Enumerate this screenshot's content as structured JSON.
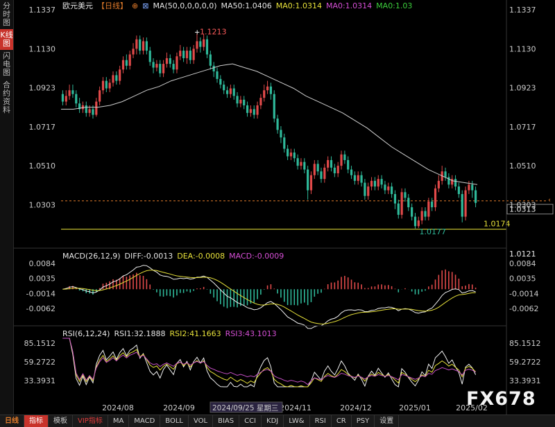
{
  "sidebar": {
    "tabs": [
      {
        "label": "分时图",
        "active": false
      },
      {
        "label": "K线图",
        "active": true
      },
      {
        "label": "闪电图",
        "active": false
      },
      {
        "label": "合约资料",
        "active": false
      }
    ]
  },
  "header": {
    "symbol": "欧元美元",
    "period": "【日线】",
    "ma_label": "MA(50,0,0,0,0,0)",
    "ma50_label": "MA50:1.0406",
    "ma0_1": "MA0:1.0314",
    "ma0_2": "MA0:1.0314",
    "ma0_3": "MA0:1.03"
  },
  "price_axis": {
    "ticks": [
      "1.1337",
      "1.1130",
      "1.0923",
      "1.0717",
      "1.0510",
      "1.0303"
    ]
  },
  "price_labels": {
    "high": "1.1213",
    "low": "1.0177",
    "support": "1.0174",
    "current": "1.0313",
    "extra": "1.0121"
  },
  "macd": {
    "title": "MACD(26,12,9)",
    "diff": "DIFF:-0.0013",
    "dea": "DEA:-0.0008",
    "macd": "MACD:-0.0009",
    "ticks": [
      "0.0084",
      "0.0035",
      "-0.0014",
      "-0.0062"
    ]
  },
  "rsi": {
    "title": "RSI(6,12,24)",
    "rsi1": "RSI1:32.1888",
    "rsi2": "RSI2:41.1663",
    "rsi3": "RSI3:43.1013",
    "ticks": [
      "85.1512",
      "59.2722",
      "33.3931"
    ]
  },
  "date_axis": {
    "labels": [
      "2024/08",
      "2024/09",
      "2024/11",
      "2024/12",
      "2025/01",
      "2025/02"
    ],
    "crosshair": "2024/09/25 星期三"
  },
  "bottom_tabs": [
    {
      "label": "日线",
      "state": "period"
    },
    {
      "label": "指标",
      "state": "active"
    },
    {
      "label": "模板",
      "state": ""
    },
    {
      "label": "VIP指标",
      "state": "hl"
    },
    {
      "label": "MA",
      "state": ""
    },
    {
      "label": "MACD",
      "state": ""
    },
    {
      "label": "BOLL",
      "state": ""
    },
    {
      "label": "VOL",
      "state": ""
    },
    {
      "label": "BIAS",
      "state": ""
    },
    {
      "label": "CCI",
      "state": ""
    },
    {
      "label": "KDJ",
      "state": ""
    },
    {
      "label": "LW&",
      "state": ""
    },
    {
      "label": "RSI",
      "state": ""
    },
    {
      "label": "CR",
      "state": ""
    },
    {
      "label": "PSY",
      "state": ""
    },
    {
      "label": "设置",
      "state": ""
    }
  ],
  "watermark": "FX678",
  "colors": {
    "up": "#e24a4a",
    "down": "#2fb99a",
    "ma50": "#cfcfcf",
    "dashed": "#e07a2a",
    "support": "#e8e23a",
    "diff": "#f2f2f2",
    "dea": "#e8e23a",
    "macd": "#d64fd6",
    "rsi1": "#f2f2f2",
    "rsi2": "#e8e23a",
    "rsi3": "#c34fc3"
  },
  "chart_data": {
    "type": "candlestick",
    "ylim": [
      1.0121,
      1.1337
    ],
    "candles": [
      [
        1.089,
        1.085,
        1.091,
        1.083
      ],
      [
        1.085,
        1.088,
        1.091,
        1.083
      ],
      [
        1.088,
        1.091,
        1.094,
        1.086
      ],
      [
        1.091,
        1.089,
        1.094,
        1.087
      ],
      [
        1.089,
        1.084,
        1.091,
        1.082
      ],
      [
        1.084,
        1.081,
        1.087,
        1.079
      ],
      [
        1.081,
        1.083,
        1.085,
        1.079
      ],
      [
        1.083,
        1.079,
        1.085,
        1.077
      ],
      [
        1.079,
        1.081,
        1.083,
        1.077
      ],
      [
        1.081,
        1.078,
        1.083,
        1.076
      ],
      [
        1.078,
        1.085,
        1.087,
        1.077
      ],
      [
        1.085,
        1.091,
        1.093,
        1.083
      ],
      [
        1.091,
        1.096,
        1.098,
        1.089
      ],
      [
        1.096,
        1.092,
        1.098,
        1.09
      ],
      [
        1.092,
        1.095,
        1.097,
        1.09
      ],
      [
        1.095,
        1.099,
        1.101,
        1.093
      ],
      [
        1.099,
        1.096,
        1.101,
        1.094
      ],
      [
        1.096,
        1.102,
        1.104,
        1.094
      ],
      [
        1.102,
        1.107,
        1.109,
        1.1
      ],
      [
        1.107,
        1.104,
        1.11,
        1.102
      ],
      [
        1.104,
        1.11,
        1.112,
        1.102
      ],
      [
        1.11,
        1.113,
        1.116,
        1.108
      ],
      [
        1.113,
        1.118,
        1.12,
        1.11
      ],
      [
        1.118,
        1.112,
        1.12,
        1.11
      ],
      [
        1.112,
        1.117,
        1.119,
        1.11
      ],
      [
        1.117,
        1.112,
        1.119,
        1.11
      ],
      [
        1.112,
        1.106,
        1.114,
        1.104
      ],
      [
        1.106,
        1.103,
        1.108,
        1.1
      ],
      [
        1.103,
        1.105,
        1.107,
        1.101
      ],
      [
        1.105,
        1.1,
        1.107,
        1.098
      ],
      [
        1.1,
        1.105,
        1.107,
        1.098
      ],
      [
        1.105,
        1.108,
        1.111,
        1.103
      ],
      [
        1.108,
        1.105,
        1.11,
        1.103
      ],
      [
        1.105,
        1.102,
        1.107,
        1.1
      ],
      [
        1.102,
        1.109,
        1.111,
        1.1
      ],
      [
        1.109,
        1.112,
        1.115,
        1.107
      ],
      [
        1.112,
        1.108,
        1.114,
        1.106
      ],
      [
        1.108,
        1.112,
        1.114,
        1.105
      ],
      [
        1.112,
        1.107,
        1.114,
        1.105
      ],
      [
        1.107,
        1.113,
        1.115,
        1.105
      ],
      [
        1.113,
        1.117,
        1.121,
        1.111
      ],
      [
        1.117,
        1.114,
        1.119,
        1.111
      ],
      [
        1.114,
        1.118,
        1.121,
        1.112
      ],
      [
        1.118,
        1.11,
        1.12,
        1.108
      ],
      [
        1.11,
        1.104,
        1.112,
        1.102
      ],
      [
        1.104,
        1.101,
        1.106,
        1.098
      ],
      [
        1.101,
        1.097,
        1.103,
        1.095
      ],
      [
        1.097,
        1.094,
        1.099,
        1.092
      ],
      [
        1.094,
        1.091,
        1.096,
        1.089
      ],
      [
        1.091,
        1.089,
        1.093,
        1.087
      ],
      [
        1.089,
        1.092,
        1.094,
        1.087
      ],
      [
        1.092,
        1.088,
        1.094,
        1.086
      ],
      [
        1.088,
        1.084,
        1.09,
        1.082
      ],
      [
        1.084,
        1.086,
        1.088,
        1.082
      ],
      [
        1.086,
        1.083,
        1.088,
        1.081
      ],
      [
        1.083,
        1.079,
        1.085,
        1.077
      ],
      [
        1.079,
        1.081,
        1.083,
        1.077
      ],
      [
        1.081,
        1.078,
        1.083,
        1.076
      ],
      [
        1.078,
        1.083,
        1.085,
        1.076
      ],
      [
        1.083,
        1.087,
        1.089,
        1.081
      ],
      [
        1.087,
        1.091,
        1.094,
        1.085
      ],
      [
        1.091,
        1.093,
        1.096,
        1.089
      ],
      [
        1.093,
        1.089,
        1.095,
        1.086
      ],
      [
        1.089,
        1.076,
        1.091,
        1.074
      ],
      [
        1.076,
        1.07,
        1.078,
        1.068
      ],
      [
        1.07,
        1.066,
        1.072,
        1.063
      ],
      [
        1.066,
        1.06,
        1.068,
        1.058
      ],
      [
        1.06,
        1.056,
        1.062,
        1.054
      ],
      [
        1.056,
        1.058,
        1.06,
        1.054
      ],
      [
        1.058,
        1.055,
        1.06,
        1.053
      ],
      [
        1.055,
        1.051,
        1.057,
        1.049
      ],
      [
        1.051,
        1.053,
        1.055,
        1.049
      ],
      [
        1.053,
        1.049,
        1.055,
        1.047
      ],
      [
        1.049,
        1.038,
        1.051,
        1.033
      ],
      [
        1.038,
        1.046,
        1.048,
        1.036
      ],
      [
        1.046,
        1.052,
        1.054,
        1.044
      ],
      [
        1.052,
        1.048,
        1.054,
        1.046
      ],
      [
        1.048,
        1.044,
        1.05,
        1.042
      ],
      [
        1.044,
        1.05,
        1.052,
        1.042
      ],
      [
        1.05,
        1.054,
        1.056,
        1.048
      ],
      [
        1.054,
        1.05,
        1.056,
        1.048
      ],
      [
        1.05,
        1.047,
        1.052,
        1.045
      ],
      [
        1.047,
        1.051,
        1.053,
        1.045
      ],
      [
        1.051,
        1.057,
        1.059,
        1.049
      ],
      [
        1.057,
        1.054,
        1.059,
        1.052
      ],
      [
        1.054,
        1.049,
        1.056,
        1.047
      ],
      [
        1.049,
        1.046,
        1.051,
        1.044
      ],
      [
        1.046,
        1.043,
        1.048,
        1.041
      ],
      [
        1.043,
        1.046,
        1.048,
        1.041
      ],
      [
        1.046,
        1.042,
        1.048,
        1.04
      ],
      [
        1.042,
        1.035,
        1.044,
        1.033
      ],
      [
        1.035,
        1.04,
        1.042,
        1.033
      ],
      [
        1.04,
        1.043,
        1.045,
        1.038
      ],
      [
        1.043,
        1.04,
        1.045,
        1.038
      ],
      [
        1.04,
        1.044,
        1.046,
        1.038
      ],
      [
        1.044,
        1.041,
        1.046,
        1.039
      ],
      [
        1.041,
        1.038,
        1.043,
        1.036
      ],
      [
        1.038,
        1.04,
        1.042,
        1.036
      ],
      [
        1.04,
        1.036,
        1.042,
        1.034
      ],
      [
        1.036,
        1.031,
        1.038,
        1.028
      ],
      [
        1.031,
        1.025,
        1.033,
        1.023
      ],
      [
        1.025,
        1.037,
        1.039,
        1.023
      ],
      [
        1.037,
        1.034,
        1.039,
        1.032
      ],
      [
        1.034,
        1.029,
        1.036,
        1.027
      ],
      [
        1.029,
        1.024,
        1.031,
        1.022
      ],
      [
        1.024,
        1.019,
        1.026,
        1.0177
      ],
      [
        1.019,
        1.022,
        1.024,
        1.018
      ],
      [
        1.022,
        1.027,
        1.029,
        1.02
      ],
      [
        1.027,
        1.024,
        1.029,
        1.022
      ],
      [
        1.024,
        1.032,
        1.034,
        1.022
      ],
      [
        1.032,
        1.029,
        1.034,
        1.027
      ],
      [
        1.029,
        1.039,
        1.041,
        1.027
      ],
      [
        1.039,
        1.043,
        1.046,
        1.037
      ],
      [
        1.043,
        1.048,
        1.051,
        1.041
      ],
      [
        1.048,
        1.045,
        1.05,
        1.043
      ],
      [
        1.045,
        1.041,
        1.047,
        1.039
      ],
      [
        1.041,
        1.044,
        1.046,
        1.039
      ],
      [
        1.044,
        1.04,
        1.046,
        1.038
      ],
      [
        1.04,
        1.036,
        1.042,
        1.034
      ],
      [
        1.036,
        1.024,
        1.038,
        1.021
      ],
      [
        1.024,
        1.038,
        1.04,
        1.022
      ],
      [
        1.038,
        1.041,
        1.043,
        1.036
      ],
      [
        1.041,
        1.038,
        1.043,
        1.034
      ],
      [
        1.038,
        1.0313,
        1.04,
        1.029
      ]
    ],
    "ma50": [
      1.081,
      1.081,
      1.082,
      1.082,
      1.083,
      1.085,
      1.088,
      1.091,
      1.093,
      1.096,
      1.098,
      1.1,
      1.102,
      1.104,
      1.105,
      1.103,
      1.101,
      1.098,
      1.095,
      1.092,
      1.088,
      1.085,
      1.082,
      1.079,
      1.075,
      1.071,
      1.066,
      1.061,
      1.057,
      1.053,
      1.049,
      1.046,
      1.043,
      1.042,
      1.041
    ],
    "rsi1_recent": 32.1888,
    "rsi2_recent": 41.1663,
    "rsi3_recent": 43.1013,
    "macd_recent": {
      "diff": -0.0013,
      "dea": -0.0008,
      "macd": -0.0009
    }
  }
}
